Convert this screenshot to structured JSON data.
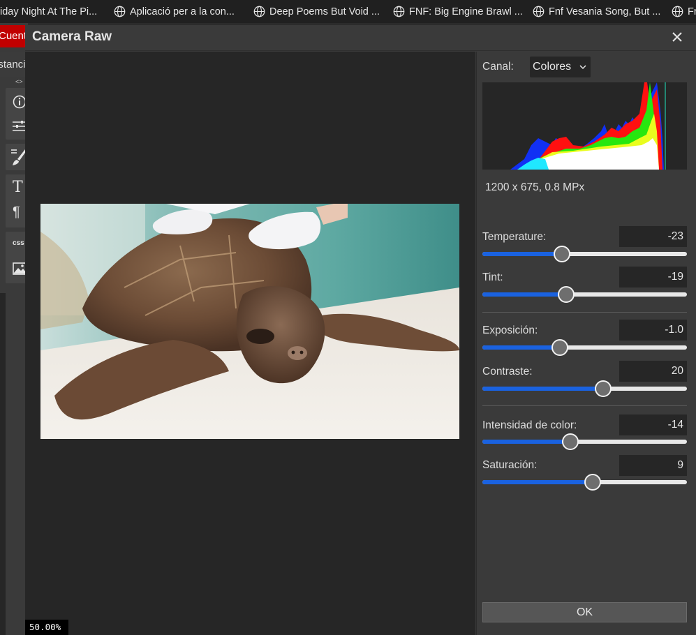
{
  "bookmarks": [
    {
      "label": "iday Night At The Pi...",
      "icon": "globe-icon"
    },
    {
      "label": "Aplicació per a la con...",
      "icon": "globe-icon"
    },
    {
      "label": "Deep Poems But Void ...",
      "icon": "globe-icon"
    },
    {
      "label": "FNF: Big Engine Brawl ...",
      "icon": "globe-icon"
    },
    {
      "label": "Fnf Vesania Song, But ...",
      "icon": "globe-icon"
    },
    {
      "label": "Fr",
      "icon": "globe-icon"
    }
  ],
  "background_app": {
    "tab_label": "Cuenta",
    "row_label": "istancia",
    "arrows": "<>",
    "css_label": "css"
  },
  "dialog": {
    "title": "Camera Raw",
    "close_icon": "close-icon",
    "zoom": "50.00%",
    "channel_label": "Canal:",
    "channel_value": "Colores",
    "image_info": "1200 x 675, 0.8 MPx",
    "ok_label": "OK",
    "sliders": [
      {
        "label": "Temperature:",
        "value": "-23",
        "fraction": 0.39
      },
      {
        "label": "Tint:",
        "value": "-19",
        "fraction": 0.41
      },
      {
        "label": "Exposición:",
        "value": "-1.0",
        "fraction": 0.38
      },
      {
        "label": "Contraste:",
        "value": "20",
        "fraction": 0.59
      },
      {
        "label": "Intensidad de color:",
        "value": "-14",
        "fraction": 0.43
      },
      {
        "label": "Saturación:",
        "value": "9",
        "fraction": 0.54
      }
    ]
  },
  "colors": {
    "slider_fill": "#1a62e0",
    "accent_red_tab": "#c00000",
    "canvas_bg": "#262626",
    "panel_bg": "#3a3a3a"
  }
}
